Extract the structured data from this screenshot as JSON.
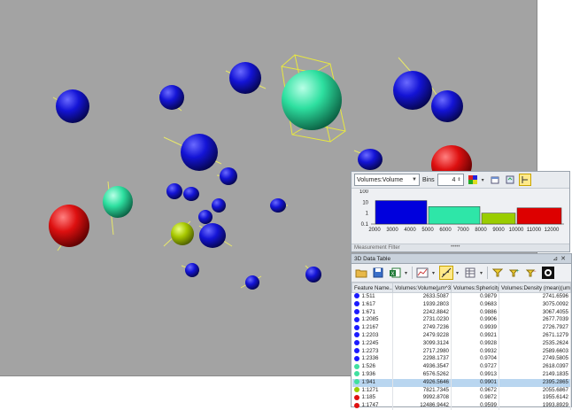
{
  "measurement_filter": {
    "selector_value": "Volumes:Volume",
    "bins_label": "Bins",
    "bins_value": "4",
    "footer_label": "Measurement Filter",
    "y_ticks": [
      "100",
      "10",
      "1",
      "0.1"
    ],
    "x_ticks": [
      "2000",
      "3000",
      "4000",
      "5000",
      "6000",
      "7000",
      "8000",
      "9000",
      "10000",
      "11000",
      "12000"
    ],
    "bars": [
      {
        "x_start": 2000,
        "x_end": 5000,
        "count": 14,
        "color": "#0000dd"
      },
      {
        "x_start": 5000,
        "x_end": 8000,
        "count": 4,
        "color": "#2ee6a8"
      },
      {
        "x_start": 8000,
        "x_end": 10000,
        "count": 1,
        "color": "#9acd00"
      },
      {
        "x_start": 10000,
        "x_end": 12600,
        "count": 3,
        "color": "#dd0000"
      }
    ]
  },
  "data_table": {
    "title": "3D Data Table",
    "columns": [
      "Feature Name...",
      "Volumes:Volume(µm^3)",
      "Volumes:Sphericity",
      "Volumes:Density (mean)(um)"
    ],
    "rows": [
      {
        "dot": "#1a1aff",
        "name": "1:511",
        "volume": "2633.5087",
        "sphericity": "0.9879",
        "density": "2741.6596",
        "selected": false
      },
      {
        "dot": "#1a1aff",
        "name": "1:617",
        "volume": "1939.2803",
        "sphericity": "0.9683",
        "density": "3075.0092",
        "selected": false
      },
      {
        "dot": "#1a1aff",
        "name": "1:671",
        "volume": "2242.8842",
        "sphericity": "0.9886",
        "density": "3067.4055",
        "selected": false
      },
      {
        "dot": "#1a1aff",
        "name": "1:2085",
        "volume": "2731.0230",
        "sphericity": "0.9906",
        "density": "2677.7039",
        "selected": false
      },
      {
        "dot": "#1a1aff",
        "name": "1:2167",
        "volume": "2749.7236",
        "sphericity": "0.9939",
        "density": "2726.7927",
        "selected": false
      },
      {
        "dot": "#1a1aff",
        "name": "1:2203",
        "volume": "2479.9228",
        "sphericity": "0.9921",
        "density": "2671.1279",
        "selected": false
      },
      {
        "dot": "#1a1aff",
        "name": "1:2245",
        "volume": "3099.3124",
        "sphericity": "0.9928",
        "density": "2535.2624",
        "selected": false
      },
      {
        "dot": "#1a1aff",
        "name": "1:2273",
        "volume": "2717.2980",
        "sphericity": "0.9932",
        "density": "2589.6603",
        "selected": false
      },
      {
        "dot": "#1a1aff",
        "name": "1:2336",
        "volume": "2298.1737",
        "sphericity": "0.9704",
        "density": "2749.5805",
        "selected": false
      },
      {
        "dot": "#3fe0a0",
        "name": "1:526",
        "volume": "4936.3547",
        "sphericity": "0.9727",
        "density": "2618.0397",
        "selected": false
      },
      {
        "dot": "#3fe0a0",
        "name": "1:936",
        "volume": "6576.5262",
        "sphericity": "0.9913",
        "density": "2149.1835",
        "selected": false
      },
      {
        "dot": "#3fe0a0",
        "name": "1:941",
        "volume": "4926.5646",
        "sphericity": "0.9901",
        "density": "2395.2865",
        "selected": true
      },
      {
        "dot": "#9acd00",
        "name": "1:1271",
        "volume": "7821.7345",
        "sphericity": "0.9672",
        "density": "2055.6867",
        "selected": false
      },
      {
        "dot": "#e01010",
        "name": "1:185",
        "volume": "9992.8708",
        "sphericity": "0.9872",
        "density": "1955.6142",
        "selected": false
      },
      {
        "dot": "#e01010",
        "name": "1:1747",
        "volume": "12486.9442",
        "sphericity": "0.9599",
        "density": "1993.8929",
        "selected": false
      }
    ]
  },
  "colors": {
    "viewport_bg": "#a3a3a3",
    "blue_sphere": "#1010d0",
    "teal_sphere": "#2ee6a8",
    "yellow_green_sphere": "#a8c800",
    "red_sphere": "#dd1010",
    "bounding_box": "#e8e840",
    "selection_row": "#b9d6f0"
  },
  "icons": [
    "dropdown-arrow-icon",
    "spin-arrows-icon",
    "color-map-icon",
    "export-icon",
    "refresh-icon",
    "filter-toggle-icon",
    "open-folder-icon",
    "save-icon",
    "excel-icon",
    "chart-icon",
    "scatter-plot-icon",
    "column-select-icon",
    "funnel-icon",
    "funnel-plus-icon",
    "funnel-minus-icon",
    "black-white-icon",
    "pin-icon",
    "close-icon"
  ]
}
